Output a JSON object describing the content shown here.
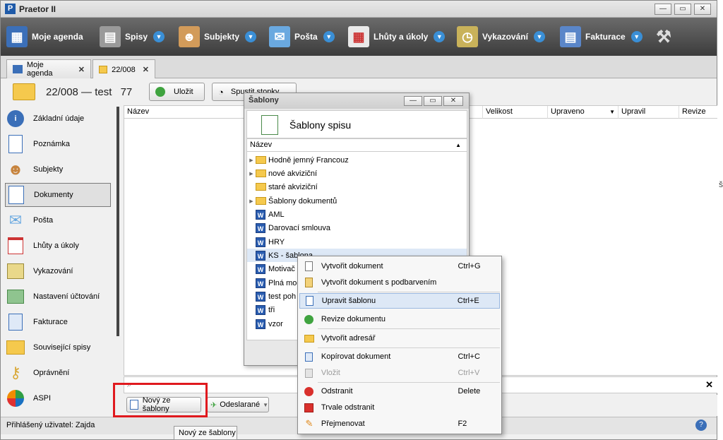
{
  "window": {
    "title": "Praetor II",
    "app_icon": "P"
  },
  "toolbar": {
    "items": [
      {
        "label": "Moje agenda"
      },
      {
        "label": "Spisy"
      },
      {
        "label": "Subjekty"
      },
      {
        "label": "Pošta"
      },
      {
        "label": "Lhůty a úkoly"
      },
      {
        "label": "Vykazování"
      },
      {
        "label": "Fakturace"
      }
    ]
  },
  "tabs": [
    {
      "label": "Moje agenda"
    },
    {
      "label": "22/008"
    }
  ],
  "header": {
    "title": "22/008 — test",
    "number": "77",
    "save_label": "Uložit",
    "stopwatch_label": "Spustit stopky"
  },
  "sidebar": {
    "items": [
      {
        "label": "Základní údaje"
      },
      {
        "label": "Poznámka"
      },
      {
        "label": "Subjekty"
      },
      {
        "label": "Dokumenty"
      },
      {
        "label": "Pošta"
      },
      {
        "label": "Lhůty a úkoly"
      },
      {
        "label": "Vykazování"
      },
      {
        "label": "Nastavení účtování"
      },
      {
        "label": "Fakturace"
      },
      {
        "label": "Související spisy"
      },
      {
        "label": "Oprávnění"
      },
      {
        "label": "ASPI"
      }
    ]
  },
  "table": {
    "columns": [
      "Název",
      "Velikost",
      "Upraveno",
      "Upravil",
      "Revize"
    ]
  },
  "bottom": {
    "new_from_template": "Nový ze šablony",
    "sent": "Odeslarané"
  },
  "status": {
    "user": "Přihlášený uživatel: Zajda"
  },
  "tooltip": "Nový ze šablony",
  "dialog": {
    "title": "Šablony",
    "heading": "Šablony spisu",
    "col": "Název",
    "rows": [
      {
        "label": "Hodně jemný Francouz"
      },
      {
        "label": "nové akviziční"
      },
      {
        "label": "staré akviziční"
      },
      {
        "label": "Šablony dokumentů"
      },
      {
        "label": "AML"
      },
      {
        "label": "Darovací smlouva"
      },
      {
        "label": "HRY"
      },
      {
        "label": "KS - šablona"
      },
      {
        "label": "Motivač"
      },
      {
        "label": "Plná moc"
      },
      {
        "label": "test poh"
      },
      {
        "label": "tři"
      },
      {
        "label": "vzor"
      }
    ]
  },
  "context_menu": {
    "items": [
      {
        "label": "Vytvořit dokument",
        "shortcut": "Ctrl+G"
      },
      {
        "label": "Vytvořit dokument s podbarvením",
        "shortcut": ""
      },
      {
        "label": "Upravit šablonu",
        "shortcut": "Ctrl+E"
      },
      {
        "label": "Revize dokumentu",
        "shortcut": ""
      },
      {
        "label": "Vytvořit adresář",
        "shortcut": ""
      },
      {
        "label": "Kopírovat dokument",
        "shortcut": "Ctrl+C"
      },
      {
        "label": "Vložit",
        "shortcut": "Ctrl+V"
      },
      {
        "label": "Odstranit",
        "shortcut": "Delete"
      },
      {
        "label": "Trvale odstranit",
        "shortcut": ""
      },
      {
        "label": "Přejmenovat",
        "shortcut": "F2"
      }
    ]
  },
  "colors": {
    "accent_red": "#e0191e",
    "toolbar_bg": "#4a4a4a",
    "highlight": "#dde8f6"
  }
}
